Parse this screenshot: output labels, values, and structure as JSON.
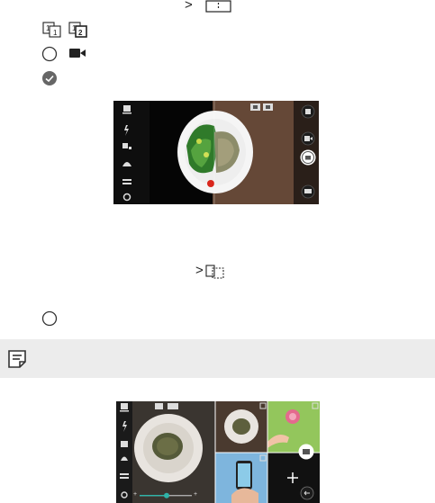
{
  "page": {
    "background": "#ffffff",
    "note_bar_color": "#ececec",
    "accent_color": "#2fb3a8"
  },
  "rows": {
    "row1": {
      "chevron": ">",
      "icon": "split-frame-icon"
    },
    "row2": {
      "icons": [
        "page-1-1-icon",
        "page-1-2-icon"
      ]
    },
    "row3": {
      "icons": [
        "shutter-outline-icon",
        "video-camera-icon"
      ]
    },
    "row4": {
      "icon": "check-circle-icon"
    },
    "row5": {
      "chevron": ">",
      "icon": "match-shot-icon"
    },
    "row6": {
      "icon": "shutter-outline-icon"
    }
  },
  "note": {
    "icon": "memo-note-icon"
  },
  "screenshot1": {
    "description_icons": [
      "camera-mode-icon",
      "flash-icon",
      "timer-icon",
      "beauty-icon",
      "filter-icon",
      "settings-icon",
      "gallery-icon",
      "video-record-icon",
      "shutter-icon",
      "switch-camera-icon"
    ]
  },
  "screenshot2": {
    "zoom_marker_left": "+",
    "zoom_marker_right": "+"
  }
}
